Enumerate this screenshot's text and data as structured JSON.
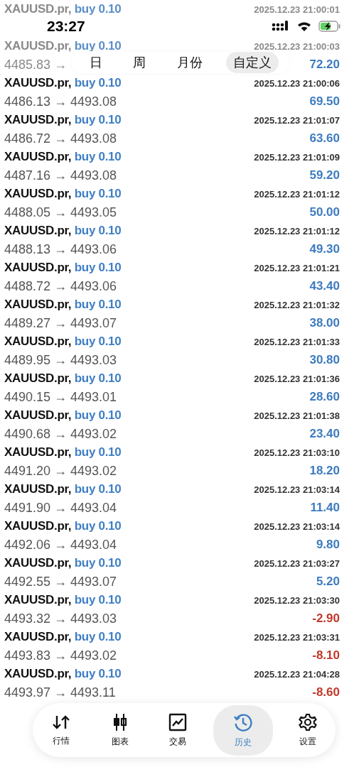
{
  "status_bar": {
    "time": "23:27"
  },
  "period_tabs": [
    {
      "label": "日",
      "selected": false
    },
    {
      "label": "周",
      "selected": false
    },
    {
      "label": "月份",
      "selected": false
    },
    {
      "label": "自定义",
      "selected": true
    }
  ],
  "trades": [
    {
      "symbol": "XAUUSD.pr,",
      "side": "buy 0.10",
      "time": "2025.12.23 21:00:01",
      "dimmed": true
    },
    {
      "symbol": "XAUUSD.pr,",
      "side": "buy 0.10",
      "time": "2025.12.23 21:00:03",
      "route": "4485.83 →",
      "profit": "72.20",
      "color": "#3d7bbf",
      "dimmed": true
    },
    {
      "symbol": "XAUUSD.pr,",
      "side": "buy 0.10",
      "time": "2025.12.23 21:00:06",
      "route": "4486.13 → 4493.08",
      "profit": "69.50",
      "color": "#3d7bbf",
      "dimmed": false
    },
    {
      "symbol": "XAUUSD.pr,",
      "side": "buy 0.10",
      "time": "2025.12.23 21:01:07",
      "route": "4486.72 → 4493.08",
      "profit": "63.60",
      "color": "#3d7bbf",
      "dimmed": false
    },
    {
      "symbol": "XAUUSD.pr,",
      "side": "buy 0.10",
      "time": "2025.12.23 21:01:09",
      "route": "4487.16 → 4493.08",
      "profit": "59.20",
      "color": "#3d7bbf",
      "dimmed": false
    },
    {
      "symbol": "XAUUSD.pr,",
      "side": "buy 0.10",
      "time": "2025.12.23 21:01:12",
      "route": "4488.05 → 4493.05",
      "profit": "50.00",
      "color": "#3d7bbf",
      "dimmed": false
    },
    {
      "symbol": "XAUUSD.pr,",
      "side": "buy 0.10",
      "time": "2025.12.23 21:01:12",
      "route": "4488.13 → 4493.06",
      "profit": "49.30",
      "color": "#3d7bbf",
      "dimmed": false
    },
    {
      "symbol": "XAUUSD.pr,",
      "side": "buy 0.10",
      "time": "2025.12.23 21:01:21",
      "route": "4488.72 → 4493.06",
      "profit": "43.40",
      "color": "#3d7bbf",
      "dimmed": false
    },
    {
      "symbol": "XAUUSD.pr,",
      "side": "buy 0.10",
      "time": "2025.12.23 21:01:32",
      "route": "4489.27 → 4493.07",
      "profit": "38.00",
      "color": "#3d7bbf",
      "dimmed": false
    },
    {
      "symbol": "XAUUSD.pr,",
      "side": "buy 0.10",
      "time": "2025.12.23 21:01:33",
      "route": "4489.95 → 4493.03",
      "profit": "30.80",
      "color": "#3d7bbf",
      "dimmed": false
    },
    {
      "symbol": "XAUUSD.pr,",
      "side": "buy 0.10",
      "time": "2025.12.23 21:01:36",
      "route": "4490.15 → 4493.01",
      "profit": "28.60",
      "color": "#3d7bbf",
      "dimmed": false
    },
    {
      "symbol": "XAUUSD.pr,",
      "side": "buy 0.10",
      "time": "2025.12.23 21:01:38",
      "route": "4490.68 → 4493.02",
      "profit": "23.40",
      "color": "#3d7bbf",
      "dimmed": false
    },
    {
      "symbol": "XAUUSD.pr,",
      "side": "buy 0.10",
      "time": "2025.12.23 21:03:10",
      "route": "4491.20 → 4493.02",
      "profit": "18.20",
      "color": "#3d7bbf",
      "dimmed": false
    },
    {
      "symbol": "XAUUSD.pr,",
      "side": "buy 0.10",
      "time": "2025.12.23 21:03:14",
      "route": "4491.90 → 4493.04",
      "profit": "11.40",
      "color": "#3d7bbf",
      "dimmed": false
    },
    {
      "symbol": "XAUUSD.pr,",
      "side": "buy 0.10",
      "time": "2025.12.23 21:03:14",
      "route": "4492.06 → 4493.04",
      "profit": "9.80",
      "color": "#3d7bbf",
      "dimmed": false
    },
    {
      "symbol": "XAUUSD.pr,",
      "side": "buy 0.10",
      "time": "2025.12.23 21:03:27",
      "route": "4492.55 → 4493.07",
      "profit": "5.20",
      "color": "#3d7bbf",
      "dimmed": false
    },
    {
      "symbol": "XAUUSD.pr,",
      "side": "buy 0.10",
      "time": "2025.12.23 21:03:30",
      "route": "4493.32 → 4493.03",
      "profit": "-2.90",
      "color": "#c0392b",
      "dimmed": false
    },
    {
      "symbol": "XAUUSD.pr,",
      "side": "buy 0.10",
      "time": "2025.12.23 21:03:31",
      "route": "4493.83 → 4493.02",
      "profit": "-8.10",
      "color": "#c0392b",
      "dimmed": false
    },
    {
      "symbol": "XAUUSD.pr,",
      "side": "buy 0.10",
      "time": "2025.12.23 21:04:28",
      "route": "4493.97 → 4493.11",
      "profit": "-8.60",
      "color": "#c0392b",
      "dimmed": false
    }
  ],
  "bottom_nav": [
    {
      "kind": "quotes",
      "label": "行情",
      "selected": false
    },
    {
      "kind": "chart",
      "label": "图表",
      "selected": false
    },
    {
      "kind": "trade",
      "label": "交易",
      "selected": false
    },
    {
      "kind": "history",
      "label": "历史",
      "selected": true
    },
    {
      "kind": "settings",
      "label": "设置",
      "selected": false
    }
  ]
}
